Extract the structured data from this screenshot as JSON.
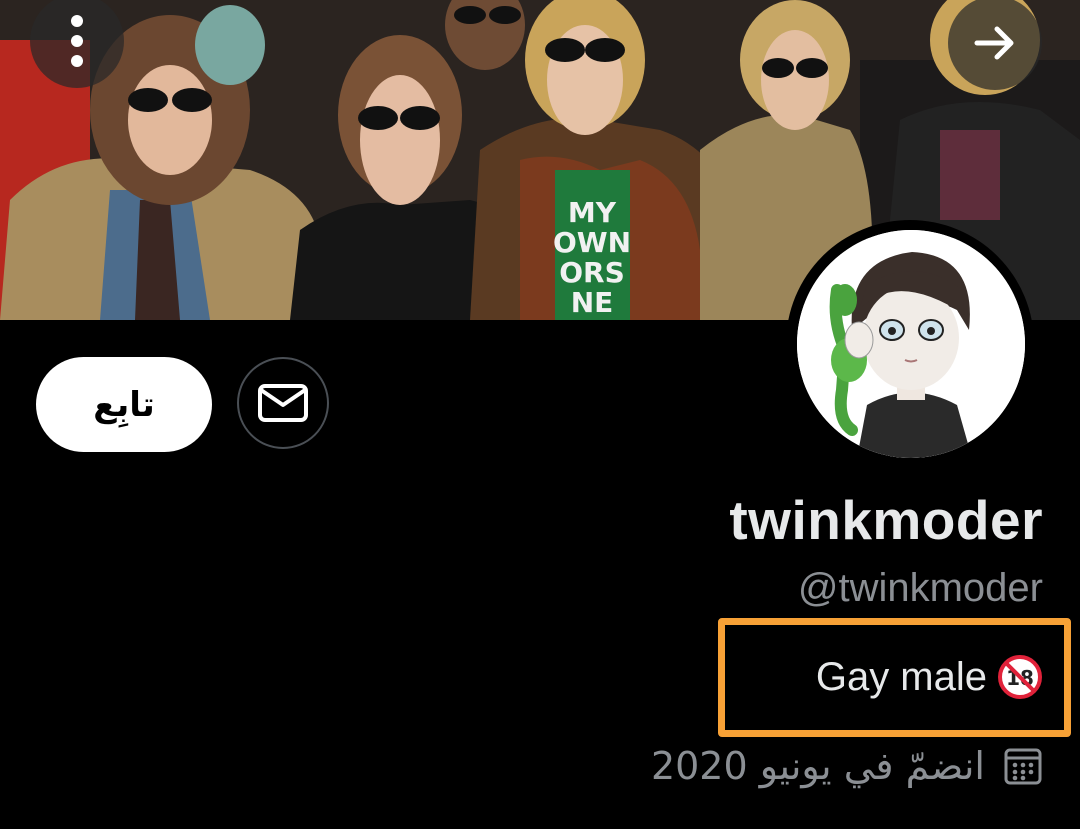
{
  "profile": {
    "display_name": "twinkmoder",
    "handle": "@twinkmoder",
    "bio": "Gay male",
    "bio_emoji": "no-under-18-icon",
    "joined": "انضمّ في يونيو 2020",
    "follow_label": "تابِع"
  },
  "banner": {
    "shirt_text": [
      "MY",
      "OWN",
      "ORS",
      "NE"
    ]
  },
  "icons": {
    "menu": "more-vertical-icon",
    "back": "arrow-right-icon",
    "message": "envelope-icon",
    "calendar": "calendar-icon"
  },
  "colors": {
    "background": "#000000",
    "text_primary": "#e7e9ea",
    "text_secondary": "#8b8f94",
    "highlight_border": "#f7a136",
    "follow_bg": "#ffffff"
  }
}
